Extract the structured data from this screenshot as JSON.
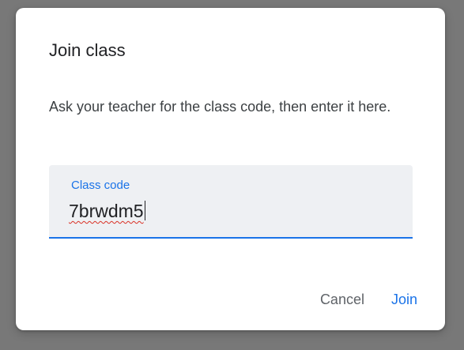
{
  "dialog": {
    "title": "Join class",
    "instructions": "Ask your teacher for the class code, then enter it here.",
    "field": {
      "label": "Class code",
      "value": "7brwdm5"
    },
    "actions": {
      "cancel_label": "Cancel",
      "join_label": "Join"
    }
  },
  "colors": {
    "accent": "#1a73e8",
    "field_background": "#eef0f3",
    "spellcheck_underline": "#d93025",
    "overlay": "#787878"
  }
}
